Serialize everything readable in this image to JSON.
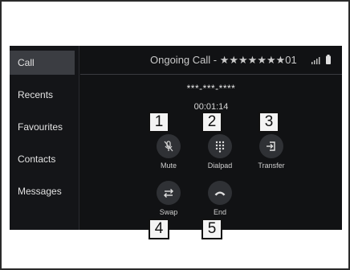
{
  "sidebar": {
    "items": [
      {
        "label": "Call",
        "active": true
      },
      {
        "label": "Recents"
      },
      {
        "label": "Favourites"
      },
      {
        "label": "Contacts"
      },
      {
        "label": "Messages"
      }
    ]
  },
  "header": {
    "title": "Ongoing Call - ★★★★★★★01",
    "signal_icon": "signal-bars-icon",
    "battery_icon": "battery-icon"
  },
  "call": {
    "number": "***-***-****",
    "duration": "00:01:14"
  },
  "controls": {
    "mute": {
      "label": "Mute",
      "icon": "mic-off-icon"
    },
    "dialpad": {
      "label": "Dialpad",
      "icon": "dialpad-icon"
    },
    "transfer": {
      "label": "Transfer",
      "icon": "transfer-icon"
    },
    "swap": {
      "label": "Swap",
      "icon": "swap-icon"
    },
    "end": {
      "label": "End",
      "icon": "hang-up-icon"
    }
  },
  "callouts": [
    "1",
    "2",
    "3",
    "4",
    "5"
  ],
  "colors": {
    "screen_bg": "#111214",
    "active_item_bg": "#3b3d42",
    "button_bg": "#2f3135"
  }
}
